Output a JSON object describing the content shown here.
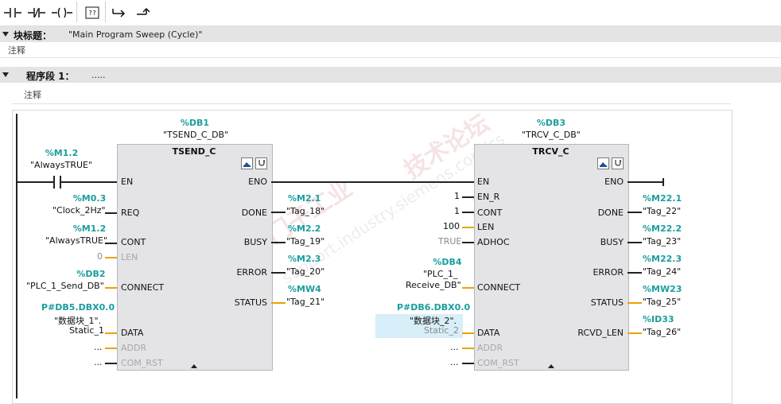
{
  "toolbar": {
    "buttons": [
      {
        "icon": "no-contact-icon"
      },
      {
        "icon": "nc-contact-icon"
      },
      {
        "icon": "coil-icon"
      },
      {
        "icon": "empty-box-icon",
        "label": "??"
      },
      {
        "icon": "open-branch-icon"
      },
      {
        "icon": "close-branch-icon"
      }
    ]
  },
  "block_header": {
    "label": "块标题：",
    "value": "\"Main Program Sweep (Cycle)\"",
    "comment": "注释"
  },
  "network": {
    "label": "程序段 1：",
    "value": ".....",
    "comment": "注释"
  },
  "contact": {
    "addr": "%M1.2",
    "tag": "\"AlwaysTRUE\""
  },
  "tsend": {
    "db_addr": "%DB1",
    "db_name": "\"TSEND_C_DB\"",
    "title": "TSEND_C",
    "inputs": [
      {
        "pin": "EN",
        "addr": "",
        "tag": ""
      },
      {
        "pin": "REQ",
        "addr": "%M0.3",
        "tag": "\"Clock_2Hz\""
      },
      {
        "pin": "CONT",
        "addr": "%M1.2",
        "tag": "\"AlwaysTRUE\""
      },
      {
        "pin": "LEN",
        "addr": "",
        "tag": "0"
      },
      {
        "pin": "CONNECT",
        "addr": "%DB2",
        "tag": "\"PLC_1_Send_DB\""
      },
      {
        "pin": "DATA",
        "addr": "P#DB5.DBX0.0",
        "tag1": "\"数据块_1\".",
        "tag2": "Static_1"
      },
      {
        "pin": "ADDR",
        "tag": "..."
      },
      {
        "pin": "COM_RST",
        "tag": "..."
      }
    ],
    "outputs": [
      {
        "pin": "ENO",
        "addr": "",
        "tag": ""
      },
      {
        "pin": "DONE",
        "addr": "%M2.1",
        "tag": "\"Tag_18\""
      },
      {
        "pin": "BUSY",
        "addr": "%M2.2",
        "tag": "\"Tag_19\""
      },
      {
        "pin": "ERROR",
        "addr": "%M2.3",
        "tag": "\"Tag_20\""
      },
      {
        "pin": "STATUS",
        "addr": "%MW4",
        "tag": "\"Tag_21\""
      }
    ]
  },
  "trcv": {
    "db_addr": "%DB3",
    "db_name": "\"TRCV_C_DB\"",
    "title": "TRCV_C",
    "inputs": [
      {
        "pin": "EN",
        "tag": ""
      },
      {
        "pin": "EN_R",
        "tag": "1"
      },
      {
        "pin": "CONT",
        "tag": "1"
      },
      {
        "pin": "LEN",
        "tag": "100"
      },
      {
        "pin": "ADHOC",
        "tag": "TRUE"
      },
      {
        "pin": "CONNECT",
        "addr": "%DB4",
        "tag1": "\"PLC_1_",
        "tag2": "Receive_DB\""
      },
      {
        "pin": "DATA",
        "addr": "P#DB6.DBX0.0",
        "tag1": "\"数据块_2\".",
        "tag2": "Static_2"
      },
      {
        "pin": "ADDR",
        "tag": "..."
      },
      {
        "pin": "COM_RST",
        "tag": "..."
      }
    ],
    "outputs": [
      {
        "pin": "ENO",
        "addr": "",
        "tag": ""
      },
      {
        "pin": "DONE",
        "addr": "%M22.1",
        "tag": "\"Tag_22\""
      },
      {
        "pin": "BUSY",
        "addr": "%M22.2",
        "tag": "\"Tag_23\""
      },
      {
        "pin": "ERROR",
        "addr": "%M22.3",
        "tag": "\"Tag_24\""
      },
      {
        "pin": "STATUS",
        "addr": "%MW23",
        "tag": "\"Tag_25\""
      },
      {
        "pin": "RCVD_LEN",
        "addr": "%ID33",
        "tag": "\"Tag_26\""
      }
    ]
  },
  "watermark": {
    "line1": "西门子工业",
    "line2": "技术论坛",
    "url": "support.industry.siemens.com/cs"
  },
  "colors": {
    "address": "#1a9e9e",
    "wire_orange": "#f0a000",
    "block_fill": "#e4e4e7",
    "section_bar": "#e4e4e4"
  }
}
